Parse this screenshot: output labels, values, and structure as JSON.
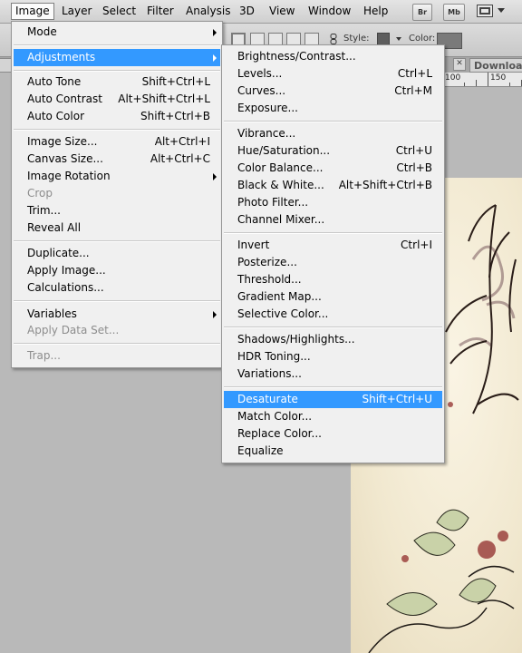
{
  "menubar": {
    "items": [
      {
        "label": "Image",
        "active": true
      },
      {
        "label": "Layer"
      },
      {
        "label": "Select"
      },
      {
        "label": "Filter"
      },
      {
        "label": "Analysis"
      },
      {
        "label": "3D"
      },
      {
        "label": "View"
      },
      {
        "label": "Window"
      },
      {
        "label": "Help"
      }
    ],
    "bridge_button": "Br",
    "minibridge_button": "Mb"
  },
  "options_bar": {
    "style_label": "Style:",
    "color_label": "Color:"
  },
  "tabs": {
    "download_tab": "Download"
  },
  "ruler": {
    "label_100": "100",
    "label_150": "150"
  },
  "image_menu": {
    "items": [
      {
        "label": "Mode",
        "submenu": true
      },
      {
        "label": "Adjustments",
        "submenu": true,
        "highlighted": true
      },
      {
        "label": "Auto Tone",
        "shortcut": "Shift+Ctrl+L"
      },
      {
        "label": "Auto Contrast",
        "shortcut": "Alt+Shift+Ctrl+L"
      },
      {
        "label": "Auto Color",
        "shortcut": "Shift+Ctrl+B"
      },
      {
        "label": "Image Size...",
        "shortcut": "Alt+Ctrl+I"
      },
      {
        "label": "Canvas Size...",
        "shortcut": "Alt+Ctrl+C"
      },
      {
        "label": "Image Rotation",
        "submenu": true
      },
      {
        "label": "Crop",
        "disabled": true
      },
      {
        "label": "Trim..."
      },
      {
        "label": "Reveal All"
      },
      {
        "label": "Duplicate..."
      },
      {
        "label": "Apply Image..."
      },
      {
        "label": "Calculations..."
      },
      {
        "label": "Variables",
        "submenu": true
      },
      {
        "label": "Apply Data Set...",
        "disabled": true
      },
      {
        "label": "Trap...",
        "disabled": true
      }
    ]
  },
  "adjustments_menu": {
    "items": [
      {
        "label": "Brightness/Contrast..."
      },
      {
        "label": "Levels...",
        "shortcut": "Ctrl+L"
      },
      {
        "label": "Curves...",
        "shortcut": "Ctrl+M"
      },
      {
        "label": "Exposure..."
      },
      {
        "label": "Vibrance..."
      },
      {
        "label": "Hue/Saturation...",
        "shortcut": "Ctrl+U"
      },
      {
        "label": "Color Balance...",
        "shortcut": "Ctrl+B"
      },
      {
        "label": "Black & White...",
        "shortcut": "Alt+Shift+Ctrl+B"
      },
      {
        "label": "Photo Filter..."
      },
      {
        "label": "Channel Mixer..."
      },
      {
        "label": "Invert",
        "shortcut": "Ctrl+I"
      },
      {
        "label": "Posterize..."
      },
      {
        "label": "Threshold..."
      },
      {
        "label": "Gradient Map..."
      },
      {
        "label": "Selective Color..."
      },
      {
        "label": "Shadows/Highlights..."
      },
      {
        "label": "HDR Toning..."
      },
      {
        "label": "Variations..."
      },
      {
        "label": "Desaturate",
        "shortcut": "Shift+Ctrl+U",
        "highlighted": true
      },
      {
        "label": "Match Color..."
      },
      {
        "label": "Replace Color..."
      },
      {
        "label": "Equalize"
      }
    ]
  },
  "colors": {
    "highlight": "#3399ff",
    "menu_bg": "#f0f0f0",
    "workspace_bg": "#b9b9b9"
  }
}
